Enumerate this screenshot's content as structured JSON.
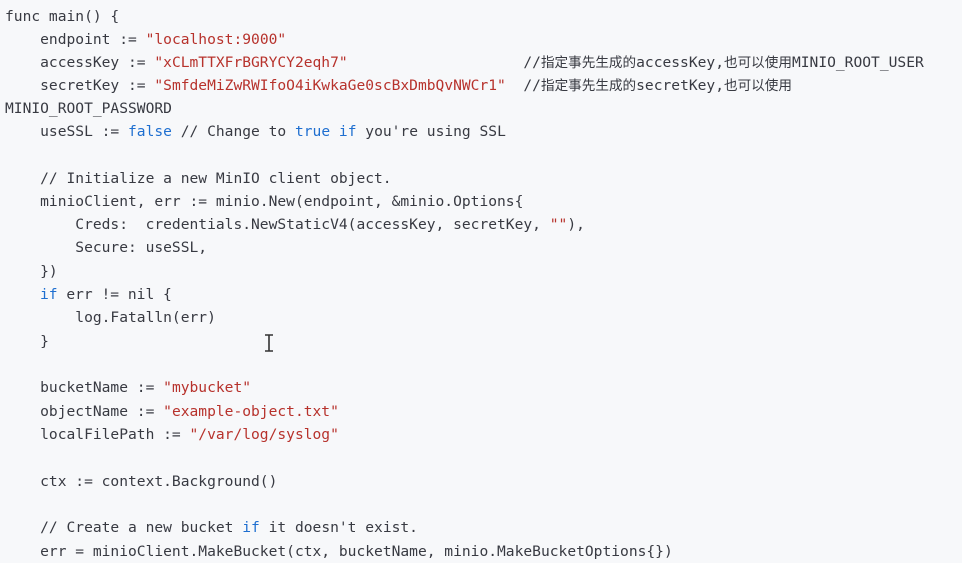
{
  "code": {
    "l1": {
      "a": "func main() {"
    },
    "l2": {
      "a": "    endpoint := ",
      "s": "\"localhost:9000\""
    },
    "l3": {
      "a": "    accessKey := ",
      "s": "\"xCLmTTXFrBGRYCY2eqh7\"",
      "c": "                    //",
      "z": "指定事先生成的",
      "c2": "accessKey,",
      "z2": "也可以使用",
      "c3": "MINIO_ROOT_USER"
    },
    "l4": {
      "a": "    secretKey := ",
      "s": "\"SmfdeMiZwRWIfoO4iKwkaGe0scBxDmbQvNWCr1\"",
      "c": "  //",
      "z": "指定事先生成的",
      "c2": "secretKey,",
      "z2": "也可以使用"
    },
    "l5": {
      "a": "MINIO_ROOT_PASSWORD"
    },
    "l6": {
      "a": "    useSSL := ",
      "k": "false",
      "b": " // Change to ",
      "k2": "true",
      "b2": " ",
      "k3": "if",
      "b3": " you're using SSL"
    },
    "l7": {
      "a": ""
    },
    "l8": {
      "a": "    // Initialize a new MinIO client object."
    },
    "l9": {
      "a": "    minioClient, err := minio.New(endpoint, &minio.Options{"
    },
    "l10": {
      "a": "        Creds:  credentials.NewStaticV4(accessKey, secretKey, ",
      "s": "\"\"",
      "b": "),"
    },
    "l11": {
      "a": "        Secure: useSSL,"
    },
    "l12": {
      "a": "    })"
    },
    "l13": {
      "k": "if",
      "b": " err != nil {"
    },
    "l14": {
      "a": "        log.Fatalln(err)"
    },
    "l15": {
      "a": "    }"
    },
    "l16": {
      "a": ""
    },
    "l17": {
      "a": "    bucketName := ",
      "s": "\"mybucket\""
    },
    "l18": {
      "a": "    objectName := ",
      "s": "\"example-object.txt\""
    },
    "l19": {
      "a": "    localFilePath := ",
      "s": "\"/var/log/syslog\""
    },
    "l20": {
      "a": ""
    },
    "l21": {
      "a": "    ctx := context.Background()"
    },
    "l22": {
      "a": ""
    },
    "l23": {
      "a": "    // Create a new bucket ",
      "k": "if",
      "b": " it doesn't exist."
    },
    "l24": {
      "a": "    err = minioClient.MakeBucket(ctx, bucketName, minio.MakeBucketOptions{})"
    }
  },
  "icons": {
    "caret": "text-cursor-icon"
  }
}
